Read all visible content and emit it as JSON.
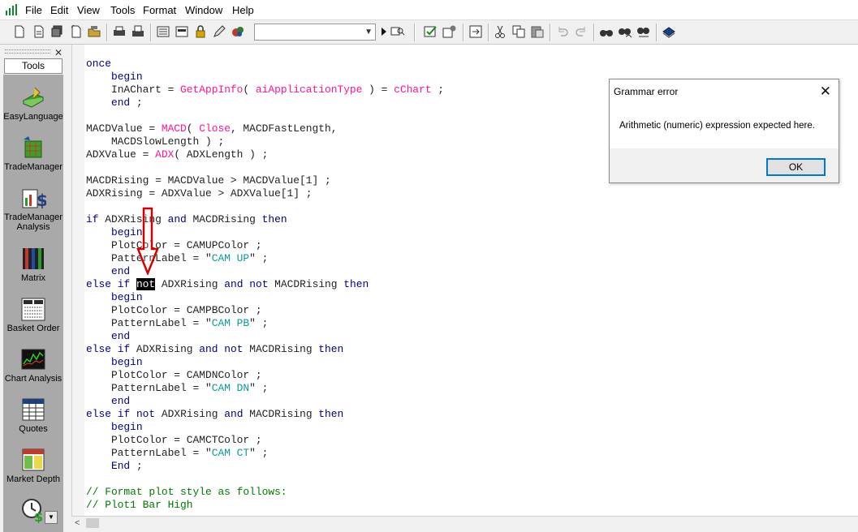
{
  "menu": {
    "items": [
      "File",
      "Edit",
      "View",
      "Tools",
      "Format",
      "Window",
      "Help"
    ]
  },
  "toolbar": {
    "combo_value": "",
    "icons": [
      "new-file-icon",
      "open-icon",
      "save-all-icon",
      "verify-icon",
      "open-folder-icon",
      "print-icon",
      "print-preview-icon",
      "properties-icon",
      "format-icon",
      "lock-icon",
      "pencil-icon",
      "insert-icon",
      "play-icon",
      "zoom-icon",
      "check-icon",
      "settings-icon",
      "export-icon",
      "cut-icon",
      "copy-icon",
      "paste-icon",
      "undo-icon",
      "redo-icon",
      "find-icon",
      "find-next-icon",
      "replace-icon",
      "help-icon"
    ]
  },
  "tools_panel": {
    "header": "Tools",
    "items": [
      {
        "label": "EasyLanguage",
        "icon": "easylanguage-icon"
      },
      {
        "label": "TradeManager",
        "icon": "trademanager-icon"
      },
      {
        "label": "TradeManager Analysis",
        "icon": "trademanager-analysis-icon"
      },
      {
        "label": "Matrix",
        "icon": "matrix-icon"
      },
      {
        "label": "Basket Order",
        "icon": "basket-order-icon"
      },
      {
        "label": "Chart Analysis",
        "icon": "chart-analysis-icon"
      },
      {
        "label": "Quotes",
        "icon": "quotes-icon"
      },
      {
        "label": "Market Depth",
        "icon": "market-depth-icon"
      }
    ]
  },
  "dialog": {
    "title": "Grammar error",
    "message": "Arithmetic (numeric) expression expected here.",
    "ok_label": "OK"
  },
  "colors": {
    "keyword": "#00008b",
    "function": "#ff1493",
    "string": "#0a9a9a",
    "comment": "#007a00",
    "arrow": "#d40000",
    "focus": "#0078d7"
  },
  "code": {
    "l1_kw": "once",
    "l2_kw": "begin",
    "l3_a": "InAChart = ",
    "l3_fn": "GetAppInfo",
    "l3_b": "( ",
    "l3_c": "aiApplicationType",
    "l3_d": " ) = ",
    "l3_e": "cChart",
    "l3_f": " ;",
    "l4_kw": "end",
    "l4_b": " ;",
    "l6_a": "MACDValue = ",
    "l6_fn": "MACD",
    "l6_b": "( ",
    "l6_c": "Close",
    "l6_d": ", MACDFastLength,",
    "l7": "    MACDSlowLength ) ;",
    "l8_a": "ADXValue = ",
    "l8_fn": "ADX",
    "l8_b": "( ADXLength ) ;",
    "l10": "MACDRising = MACDValue > MACDValue[1] ;",
    "l11": "ADXRising = ADXValue > ADXValue[1] ;",
    "l13_if": "if",
    "l13_a": " ADXRising ",
    "l13_and": "and",
    "l13_b": " MACDRising ",
    "l13_then": "then",
    "l14_kw": "begin",
    "l15": "    PlotColor = CAMUPColor ;",
    "l16_a": "    PatternLabel = \"",
    "l16_s": "CAM UP",
    "l16_b": "\" ;",
    "l17_kw": "end",
    "l18_else": "else",
    "l18_if": "if",
    "l18_not": "not",
    "l18_a": " ADXRising ",
    "l18_and": "and",
    "l18_not2": "not",
    "l18_b": " MACDRising ",
    "l18_then": "then",
    "l19_kw": "begin",
    "l20": "    PlotColor = CAMPBColor ;",
    "l21_a": "    PatternLabel = \"",
    "l21_s": "CAM PB",
    "l21_b": "\" ;",
    "l22_kw": "end",
    "l23_else": "else",
    "l23_if": "if",
    "l23_a": " ADXRising ",
    "l23_and": "and",
    "l23_not": "not",
    "l23_b": " MACDRising ",
    "l23_then": "then",
    "l24_kw": "begin",
    "l25": "    PlotColor = CAMDNColor ;",
    "l26_a": "    PatternLabel = \"",
    "l26_s": "CAM DN",
    "l26_b": "\" ;",
    "l27_kw": "end",
    "l28_else": "else",
    "l28_if": "if",
    "l28_not": "not",
    "l28_a": " ADXRising ",
    "l28_and": "and",
    "l28_b": " MACDRising ",
    "l28_then": "then",
    "l29_kw": "begin",
    "l30": "    PlotColor = CAMCTColor ;",
    "l31_a": "    PatternLabel = \"",
    "l31_s": "CAM CT",
    "l31_b": "\" ;",
    "l32_kw": "End",
    "l32_b": " ;",
    "l34": "// Format plot style as follows:",
    "l35": "// Plot1 Bar High"
  }
}
